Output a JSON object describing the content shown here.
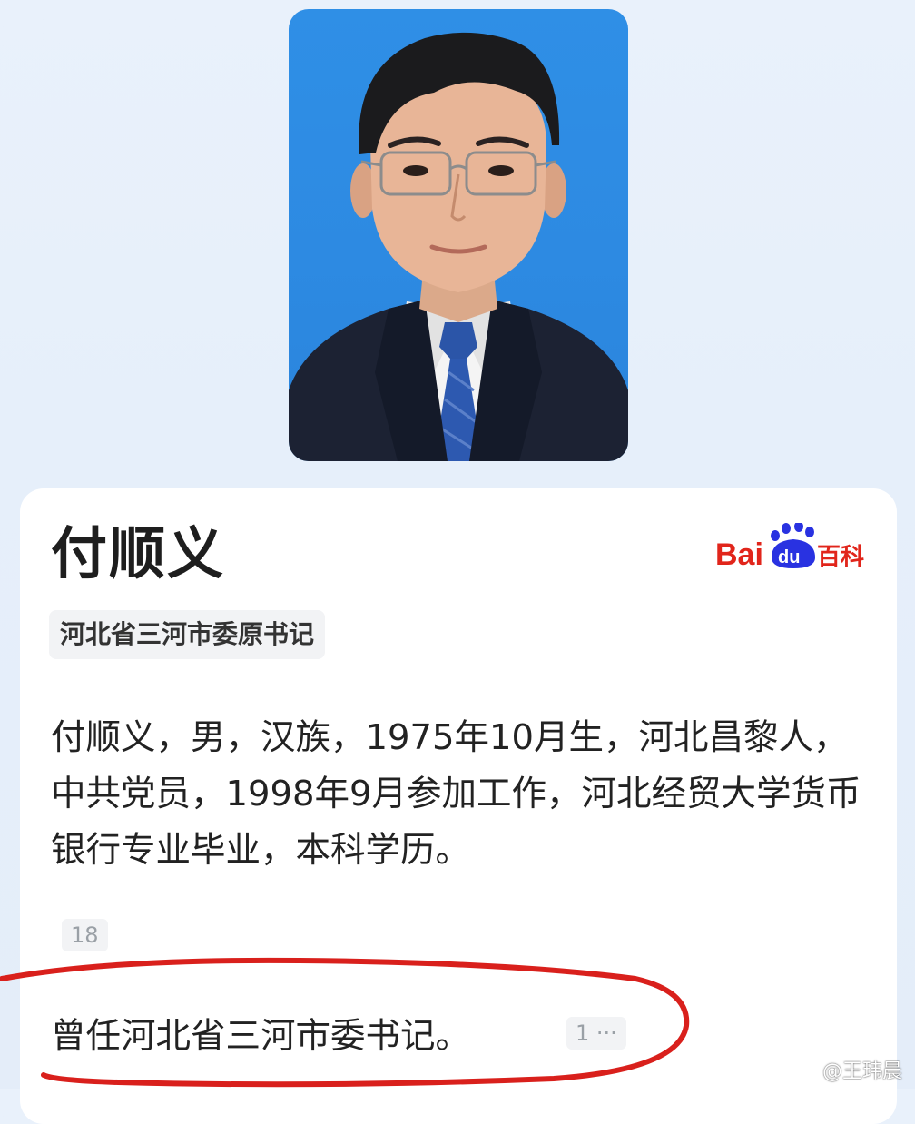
{
  "person": {
    "name": "付顺义",
    "title_tag": "河北省三河市委原书记",
    "bio": "付顺义，男，汉族，1975年10月生，河北昌黎人，中共党员，1998年9月参加工作，河北经贸大学货币银行专业毕业，本科学历。",
    "bio_ref": "18",
    "former_post": "曾任河北省三河市委书记。",
    "former_ref": "1 ···"
  },
  "logo": {
    "icon": "baidu-baike-logo",
    "brand_colors": {
      "red": "#e1251b",
      "blue": "#2932e1"
    }
  },
  "annotation": {
    "color": "#d9201c"
  },
  "watermark": {
    "handle": "@王玮晨",
    "icon": "weibo-icon"
  },
  "colors": {
    "page_bg": "#e6effa",
    "photo_bg": "#2d8ae2",
    "card_bg": "#ffffff",
    "tag_bg": "#f2f3f5"
  }
}
